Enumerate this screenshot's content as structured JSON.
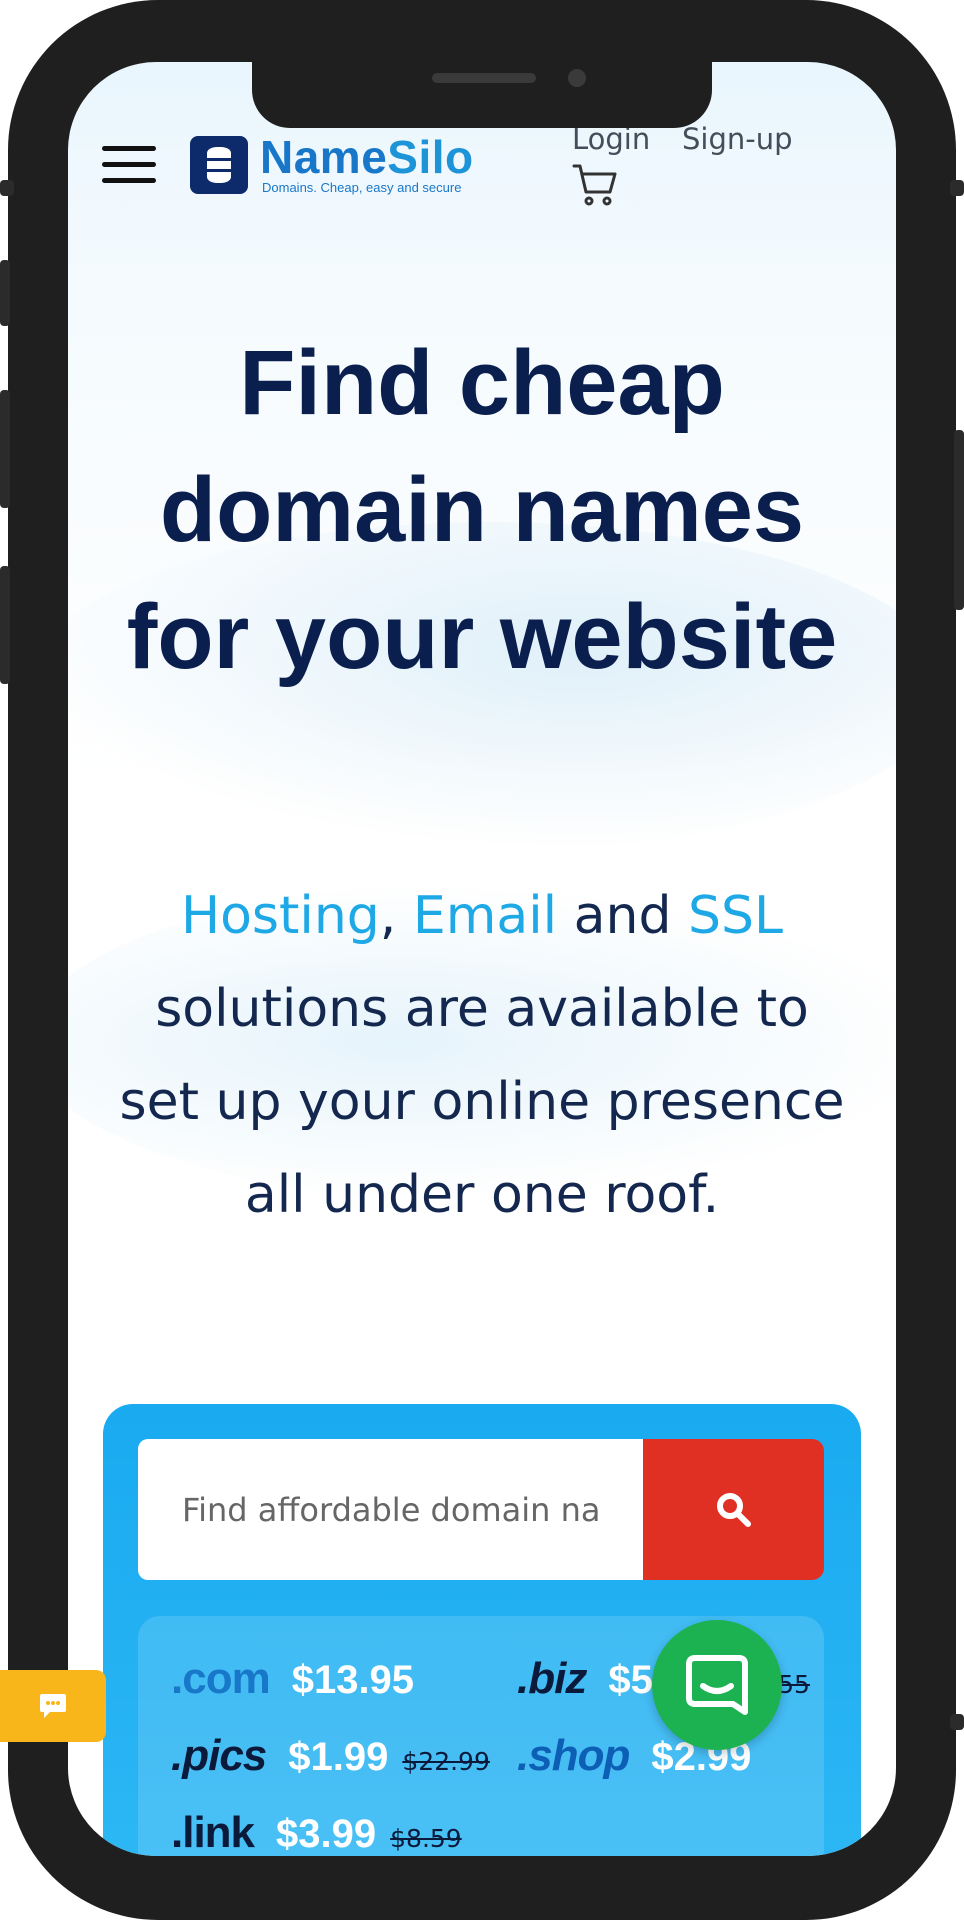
{
  "colors": {
    "accent": "#1fa8e6",
    "heading": "#0a1f4d",
    "search_button": "#e03024",
    "panel": "#19aaf0",
    "chat_tab": "#f9b61b",
    "chat_fab": "#1db251"
  },
  "header": {
    "menu_icon": "hamburger-icon",
    "logo": {
      "name_part1": "Name",
      "name_part2": "Silo",
      "tagline": "Domains. Cheap, easy and secure"
    },
    "login_label": "Login",
    "signup_label": "Sign-up",
    "cart_icon": "cart-icon"
  },
  "hero": {
    "title": "Find cheap domain names for your website",
    "subtitle_hosting": "Hosting",
    "subtitle_comma": ",",
    "subtitle_email": "Email",
    "subtitle_and": "and",
    "subtitle_ssl": "SSL",
    "subtitle_rest": "solutions are available to set up your online presence all under one roof."
  },
  "search": {
    "placeholder": "Find affordable domain names",
    "button_icon": "search-icon"
  },
  "tlds": [
    {
      "name": ".com",
      "price": "$13.95",
      "old_price": ""
    },
    {
      "name": ".biz",
      "price": "$5.75",
      "old_price": "$15.55"
    },
    {
      "name": ".pics",
      "price": "$1.99",
      "old_price": "$22.99"
    },
    {
      "name": ".shop",
      "price": "$2.99",
      "old_price": ""
    },
    {
      "name": ".link",
      "price": "$3.99",
      "old_price": "$8.59"
    }
  ],
  "widgets": {
    "chat_tab_icon": "chat-bubble-icon",
    "chat_fab_icon": "messenger-icon"
  }
}
